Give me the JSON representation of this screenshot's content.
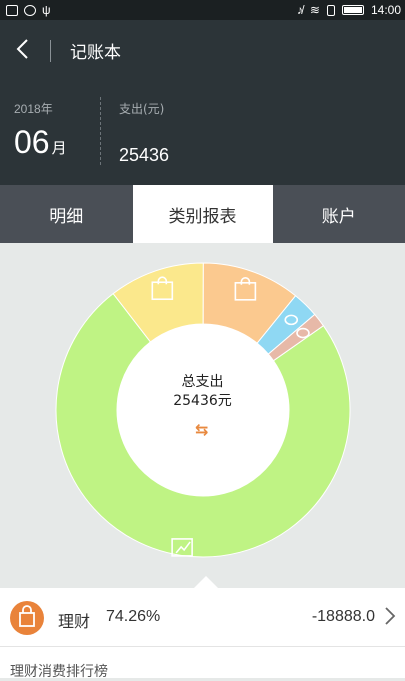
{
  "status_bar": {
    "time": "14:00"
  },
  "nav": {
    "title": "记账本"
  },
  "summary": {
    "year": "2018年",
    "month": "06",
    "month_unit": "月",
    "expense_label": "支出(元)",
    "expense_value": "25436"
  },
  "tabs": [
    "明细",
    "类别报表",
    "账户"
  ],
  "active_tab": 1,
  "chart_data": {
    "type": "pie",
    "style": "donut",
    "center_line1": "总支出",
    "center_line2": "25436元",
    "slices": [
      {
        "category": "理财",
        "value": 74.26,
        "color": "#bff384",
        "icon": "chart-growth-icon"
      },
      {
        "category": "",
        "value": 10.5,
        "color": "#fbe88c",
        "icon": "gift-icon"
      },
      {
        "category": "",
        "value": 10.8,
        "color": "#fbc98f",
        "icon": "shopping-bag-icon"
      },
      {
        "category": "",
        "value": 2.9,
        "color": "#8fd8f3",
        "icon": "other-icon"
      },
      {
        "category": "",
        "value": 1.54,
        "color": "#e7b9a8",
        "icon": "other-icon"
      }
    ],
    "colors": {
      "hole": "#ffffff",
      "background": "#e6e9e8"
    }
  },
  "selected_category": {
    "icon": "shopping-bag-icon",
    "name": "理财",
    "percent": "74.26%",
    "amount": "-18888.0"
  },
  "ranking": {
    "title": "理财消费排行榜"
  }
}
